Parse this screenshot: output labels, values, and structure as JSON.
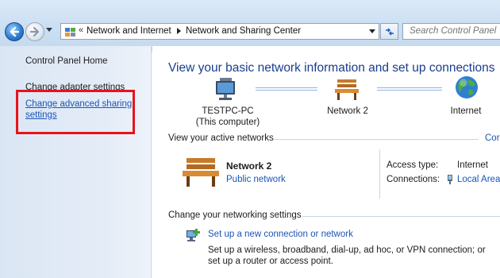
{
  "address_bar": {
    "overflow_marker": "«",
    "breadcrumbs": [
      "Network and Internet",
      "Network and Sharing Center"
    ]
  },
  "search": {
    "placeholder": "Search Control Panel"
  },
  "sidebar": {
    "items": [
      {
        "label": "Control Panel Home"
      },
      {
        "label": "Change adapter settings"
      },
      {
        "label": "Change advanced sharing settings"
      }
    ],
    "highlight_color": "#e8131b"
  },
  "main": {
    "title": "View your basic network information and set up connections",
    "network_map": {
      "computer": {
        "name": "TESTPC-PC",
        "subtitle": "(This computer)",
        "icon": "computer-icon"
      },
      "network": {
        "name": "Network  2",
        "icon": "bench-icon"
      },
      "internet": {
        "name": "Internet",
        "icon": "globe-icon"
      }
    },
    "active_networks": {
      "heading": "View your active networks",
      "connect_link": "Cor",
      "network_name": "Network  2",
      "network_type": "Public network",
      "access_type_label": "Access type:",
      "access_type_value": "Internet",
      "connections_label": "Connections:",
      "connections_value": "Local Area"
    },
    "change_settings": {
      "heading": "Change your networking settings",
      "setup_link": "Set up a new connection or network",
      "setup_description": "Set up a wireless, broadband, dial-up, ad hoc, or VPN connection; or set up a router or access point."
    }
  },
  "colors": {
    "title_blue": "#1a3d8f",
    "link_blue": "#1a55b7"
  }
}
